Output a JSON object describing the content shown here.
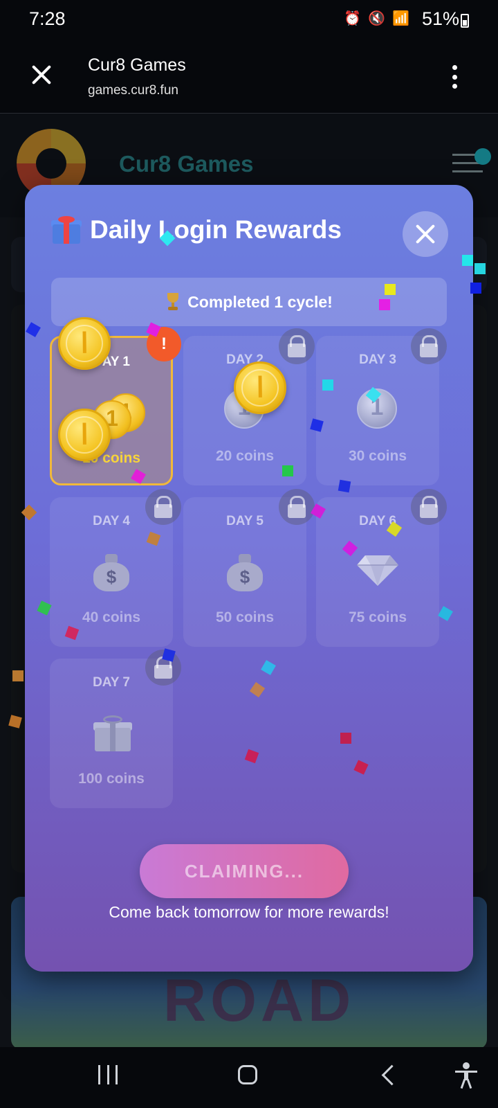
{
  "status_bar": {
    "time": "7:28",
    "battery": "51%"
  },
  "browser": {
    "title": "Cur8 Games",
    "url": "games.cur8.fun"
  },
  "site": {
    "brand": "Cur8 Games",
    "background_game_text": "ROAD"
  },
  "modal": {
    "title": "Daily Login Rewards",
    "banner": "Completed 1 cycle!",
    "days": [
      {
        "label": "DAY 1",
        "coins": "10 coins",
        "icon": "gold-coins-icon",
        "status": "claimable"
      },
      {
        "label": "DAY 2",
        "coins": "20 coins",
        "icon": "silver-coin-icon",
        "status": "locked"
      },
      {
        "label": "DAY 3",
        "coins": "30 coins",
        "icon": "silver-coin-icon",
        "status": "locked"
      },
      {
        "label": "DAY 4",
        "coins": "40 coins",
        "icon": "money-bag-icon",
        "status": "locked"
      },
      {
        "label": "DAY 5",
        "coins": "50 coins",
        "icon": "money-bag-icon",
        "status": "locked"
      },
      {
        "label": "DAY 6",
        "coins": "75 coins",
        "icon": "diamond-icon",
        "status": "locked"
      },
      {
        "label": "DAY 7",
        "coins": "100 coins",
        "icon": "gift-icon",
        "status": "locked"
      }
    ],
    "alert_badge": "!",
    "claim_button": "CLAIMING...",
    "footer": "Come back tomorrow for more rewards!"
  },
  "colors": {
    "modal_top": "#6c7fe0",
    "modal_bottom": "#7452b0",
    "active_border": "#f1b93a",
    "active_coins_text": "#f7d43a",
    "alert": "#f25a2a",
    "brand_text": "#1d5a5e"
  }
}
